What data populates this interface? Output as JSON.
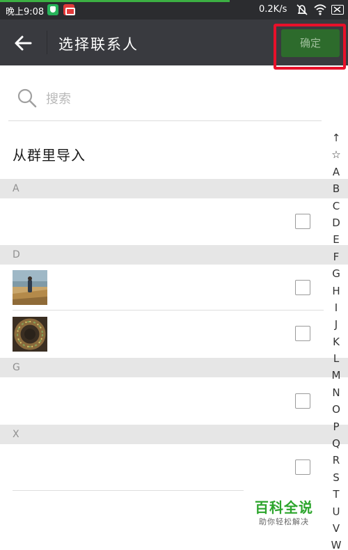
{
  "status_bar": {
    "time": "晚上9:08",
    "net_speed": "0.2K/s",
    "icons": [
      "shield-app-icon",
      "red-app-icon",
      "mute-icon",
      "wifi-icon",
      "battery-icon"
    ]
  },
  "header": {
    "back_icon": "arrow-left-icon",
    "title": "选择联系人",
    "confirm_label": "确定"
  },
  "search": {
    "placeholder": "搜索",
    "value": ""
  },
  "import_from_group": "从群里导入",
  "sections": [
    {
      "letter": "A",
      "contacts": [
        {
          "avatar": "none",
          "checked": false
        }
      ]
    },
    {
      "letter": "D",
      "contacts": [
        {
          "avatar": "photo-field-person",
          "checked": false
        },
        {
          "avatar": "photo-bead-wreath",
          "checked": false
        }
      ]
    },
    {
      "letter": "G",
      "contacts": [
        {
          "avatar": "none",
          "checked": false
        }
      ]
    },
    {
      "letter": "X",
      "contacts": [
        {
          "avatar": "none",
          "checked": false
        }
      ]
    }
  ],
  "alphabet_index": [
    "↑",
    "☆",
    "A",
    "B",
    "C",
    "D",
    "E",
    "F",
    "G",
    "H",
    "I",
    "J",
    "K",
    "L",
    "M",
    "N",
    "O",
    "P",
    "Q",
    "R",
    "S",
    "T",
    "U",
    "V",
    "W"
  ],
  "watermark": {
    "title": "百科全说",
    "subtitle": "助你轻松解决"
  },
  "colors": {
    "header_bg": "#393a3f",
    "confirm_bg": "#2d6b2c",
    "highlight": "#e8102a",
    "progress": "#3cb043",
    "section_bg": "#e6e6e6"
  }
}
